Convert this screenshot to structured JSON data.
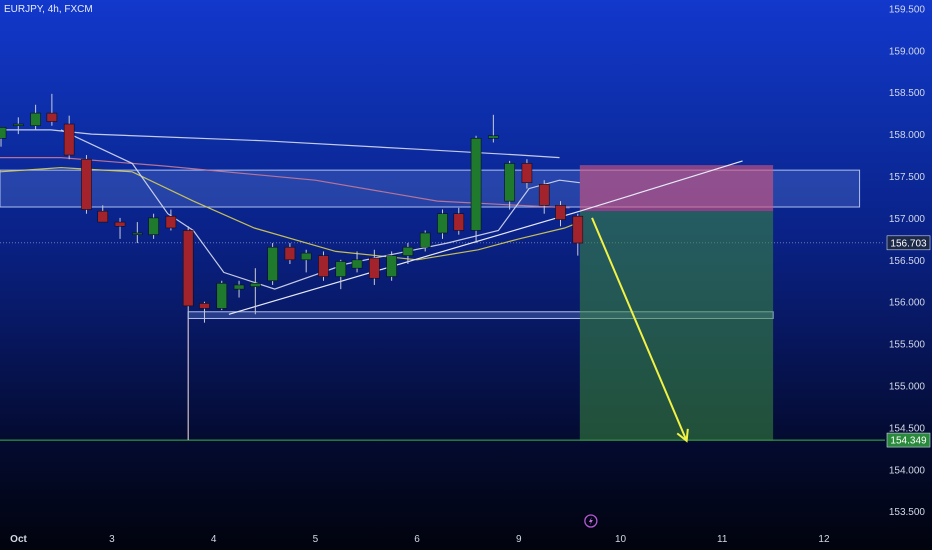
{
  "header": {
    "title": "EURJPY, 4h, FXCM"
  },
  "colors": {
    "up": "#1f7a2e",
    "down": "#a3232c",
    "wick": "#c9ccd6",
    "stop_zone": "#d2557e",
    "target_zone": "#3a8a3f",
    "resistance_band": "#6f8fe0",
    "arrow": "#f2f244",
    "ma_white": "#d8ddf0",
    "ma_pink": "#c77a96",
    "ma_yellow": "#d9cf52",
    "target_line": "#39b34a",
    "current_price_bg": "#1c2847",
    "target_price_bg": "#2a8a3c"
  },
  "labels": {
    "current_price": "156.703",
    "target_price": "154.349",
    "lightning_icon": "lightning-icon"
  },
  "chart_data": {
    "type": "candlestick",
    "title": "EURJPY, 4h, FXCM",
    "ylim": [
      153.3,
      159.6
    ],
    "y_ticks": [
      159.5,
      159.0,
      158.5,
      158.0,
      157.5,
      157.0,
      156.5,
      156.0,
      155.5,
      155.0,
      154.5,
      154.0,
      153.5
    ],
    "y_tick_labels": [
      "159.500",
      "159.000",
      "158.500",
      "158.000",
      "157.500",
      "157.000",
      "156.500",
      "156.000",
      "155.500",
      "155.000",
      "154.500",
      "154.000",
      "153.500"
    ],
    "x_ticks": [
      {
        "label": "Oct",
        "day": 2.0,
        "bold": true
      },
      {
        "label": "3",
        "day": 3.0
      },
      {
        "label": "4",
        "day": 4.0
      },
      {
        "label": "5",
        "day": 5.0
      },
      {
        "label": "6",
        "day": 6.0
      },
      {
        "label": "9",
        "day": 7.0
      },
      {
        "label": "10",
        "day": 8.0
      },
      {
        "label": "11",
        "day": 9.0
      },
      {
        "label": "12",
        "day": 10.0
      }
    ],
    "x_range_days": [
      1.9,
      10.6
    ],
    "candles": [
      {
        "t": 1.91,
        "o": 157.95,
        "h": 158.08,
        "l": 157.85,
        "c": 158.08
      },
      {
        "t": 2.08,
        "o": 158.1,
        "h": 158.2,
        "l": 158.0,
        "c": 158.12
      },
      {
        "t": 2.25,
        "o": 158.1,
        "h": 158.35,
        "l": 158.05,
        "c": 158.25
      },
      {
        "t": 2.41,
        "o": 158.25,
        "h": 158.48,
        "l": 158.1,
        "c": 158.15
      },
      {
        "t": 2.58,
        "o": 158.12,
        "h": 158.22,
        "l": 157.7,
        "c": 157.75
      },
      {
        "t": 2.75,
        "o": 157.7,
        "h": 157.75,
        "l": 157.05,
        "c": 157.1
      },
      {
        "t": 2.91,
        "o": 157.08,
        "h": 157.15,
        "l": 156.95,
        "c": 156.95
      },
      {
        "t": 3.08,
        "o": 156.95,
        "h": 157.0,
        "l": 156.75,
        "c": 156.9
      },
      {
        "t": 3.25,
        "o": 156.8,
        "h": 156.95,
        "l": 156.7,
        "c": 156.82
      },
      {
        "t": 3.41,
        "o": 156.8,
        "h": 157.05,
        "l": 156.75,
        "c": 157.0
      },
      {
        "t": 3.58,
        "o": 157.02,
        "h": 157.1,
        "l": 156.85,
        "c": 156.88
      },
      {
        "t": 3.75,
        "o": 156.85,
        "h": 156.9,
        "l": 154.35,
        "c": 155.95
      },
      {
        "t": 3.91,
        "o": 155.98,
        "h": 156.0,
        "l": 155.75,
        "c": 155.92
      },
      {
        "t": 4.08,
        "o": 155.92,
        "h": 156.25,
        "l": 155.9,
        "c": 156.22
      },
      {
        "t": 4.25,
        "o": 156.15,
        "h": 156.25,
        "l": 156.05,
        "c": 156.2
      },
      {
        "t": 4.41,
        "o": 156.18,
        "h": 156.4,
        "l": 155.85,
        "c": 156.22
      },
      {
        "t": 4.58,
        "o": 156.25,
        "h": 156.7,
        "l": 156.2,
        "c": 156.65
      },
      {
        "t": 4.75,
        "o": 156.65,
        "h": 156.7,
        "l": 156.45,
        "c": 156.5
      },
      {
        "t": 4.91,
        "o": 156.5,
        "h": 156.62,
        "l": 156.35,
        "c": 156.58
      },
      {
        "t": 5.08,
        "o": 156.55,
        "h": 156.6,
        "l": 156.25,
        "c": 156.3
      },
      {
        "t": 5.25,
        "o": 156.3,
        "h": 156.5,
        "l": 156.15,
        "c": 156.48
      },
      {
        "t": 5.41,
        "o": 156.4,
        "h": 156.6,
        "l": 156.35,
        "c": 156.5
      },
      {
        "t": 5.58,
        "o": 156.52,
        "h": 156.62,
        "l": 156.2,
        "c": 156.28
      },
      {
        "t": 5.75,
        "o": 156.3,
        "h": 156.6,
        "l": 156.25,
        "c": 156.55
      },
      {
        "t": 5.91,
        "o": 156.55,
        "h": 156.7,
        "l": 156.45,
        "c": 156.65
      },
      {
        "t": 6.08,
        "o": 156.65,
        "h": 156.85,
        "l": 156.6,
        "c": 156.82
      },
      {
        "t": 6.25,
        "o": 156.82,
        "h": 157.1,
        "l": 156.75,
        "c": 157.05
      },
      {
        "t": 6.41,
        "o": 157.05,
        "h": 157.12,
        "l": 156.8,
        "c": 156.85
      },
      {
        "t": 6.58,
        "o": 156.85,
        "h": 157.98,
        "l": 156.7,
        "c": 157.95
      },
      {
        "t": 6.75,
        "o": 157.95,
        "h": 158.23,
        "l": 157.9,
        "c": 157.98
      },
      {
        "t": 6.91,
        "o": 157.2,
        "h": 157.68,
        "l": 157.1,
        "c": 157.65
      },
      {
        "t": 7.08,
        "o": 157.65,
        "h": 157.7,
        "l": 157.35,
        "c": 157.42
      },
      {
        "t": 7.25,
        "o": 157.4,
        "h": 157.45,
        "l": 157.05,
        "c": 157.15
      },
      {
        "t": 7.41,
        "o": 157.15,
        "h": 157.2,
        "l": 156.9,
        "c": 156.98
      },
      {
        "t": 7.58,
        "o": 157.02,
        "h": 157.05,
        "l": 156.55,
        "c": 156.7
      }
    ],
    "moving_averages": [
      {
        "color_key": "ma_white",
        "points": [
          [
            1.9,
            158.05
          ],
          [
            2.4,
            158.05
          ],
          [
            2.8,
            158.0
          ],
          [
            4.5,
            157.92
          ],
          [
            6.0,
            157.82
          ],
          [
            7.0,
            157.75
          ],
          [
            7.4,
            157.72
          ]
        ]
      },
      {
        "color_key": "ma_pink",
        "points": [
          [
            1.9,
            157.72
          ],
          [
            2.5,
            157.72
          ],
          [
            3.5,
            157.62
          ],
          [
            5.0,
            157.45
          ],
          [
            6.2,
            157.2
          ],
          [
            7.0,
            157.15
          ],
          [
            7.5,
            157.12
          ]
        ]
      },
      {
        "color_key": "ma_yellow",
        "points": [
          [
            1.9,
            157.55
          ],
          [
            2.5,
            157.6
          ],
          [
            3.2,
            157.55
          ],
          [
            3.8,
            157.2
          ],
          [
            4.4,
            156.88
          ],
          [
            5.2,
            156.6
          ],
          [
            6.0,
            156.5
          ],
          [
            6.6,
            156.62
          ],
          [
            7.0,
            156.75
          ],
          [
            7.45,
            156.88
          ],
          [
            7.6,
            156.95
          ]
        ]
      },
      {
        "color_key": "ma_white",
        "points": [
          [
            2.5,
            158.05
          ],
          [
            3.2,
            157.65
          ],
          [
            3.55,
            157.05
          ],
          [
            3.8,
            156.85
          ],
          [
            4.1,
            156.35
          ],
          [
            4.6,
            156.15
          ],
          [
            5.3,
            156.45
          ],
          [
            6.3,
            156.7
          ],
          [
            6.8,
            156.85
          ],
          [
            7.1,
            157.35
          ],
          [
            7.4,
            157.45
          ],
          [
            7.6,
            157.42
          ]
        ]
      }
    ],
    "trendlines": [
      {
        "from": [
          4.15,
          155.85
        ],
        "to": [
          7.6,
          157.08
        ]
      },
      {
        "from": [
          7.6,
          157.08
        ],
        "to": [
          9.2,
          157.68
        ]
      }
    ],
    "resistance_band": {
      "from_day": 1.9,
      "to_day": 10.35,
      "top": 157.57,
      "bottom": 157.13
    },
    "support_band": {
      "from_day": 3.75,
      "to_day": 9.5,
      "top": 155.88,
      "bottom": 155.8
    },
    "position": {
      "from_day": 7.6,
      "to_day": 9.5,
      "entry": 157.08,
      "stop": 157.63,
      "target": 154.34
    },
    "arrow": {
      "from": [
        7.72,
        157.0
      ],
      "to": [
        8.65,
        154.34
      ]
    },
    "current_price": 156.703,
    "target_price": 154.349,
    "low_wick_marker": {
      "day": 3.75,
      "low": 154.35
    }
  }
}
